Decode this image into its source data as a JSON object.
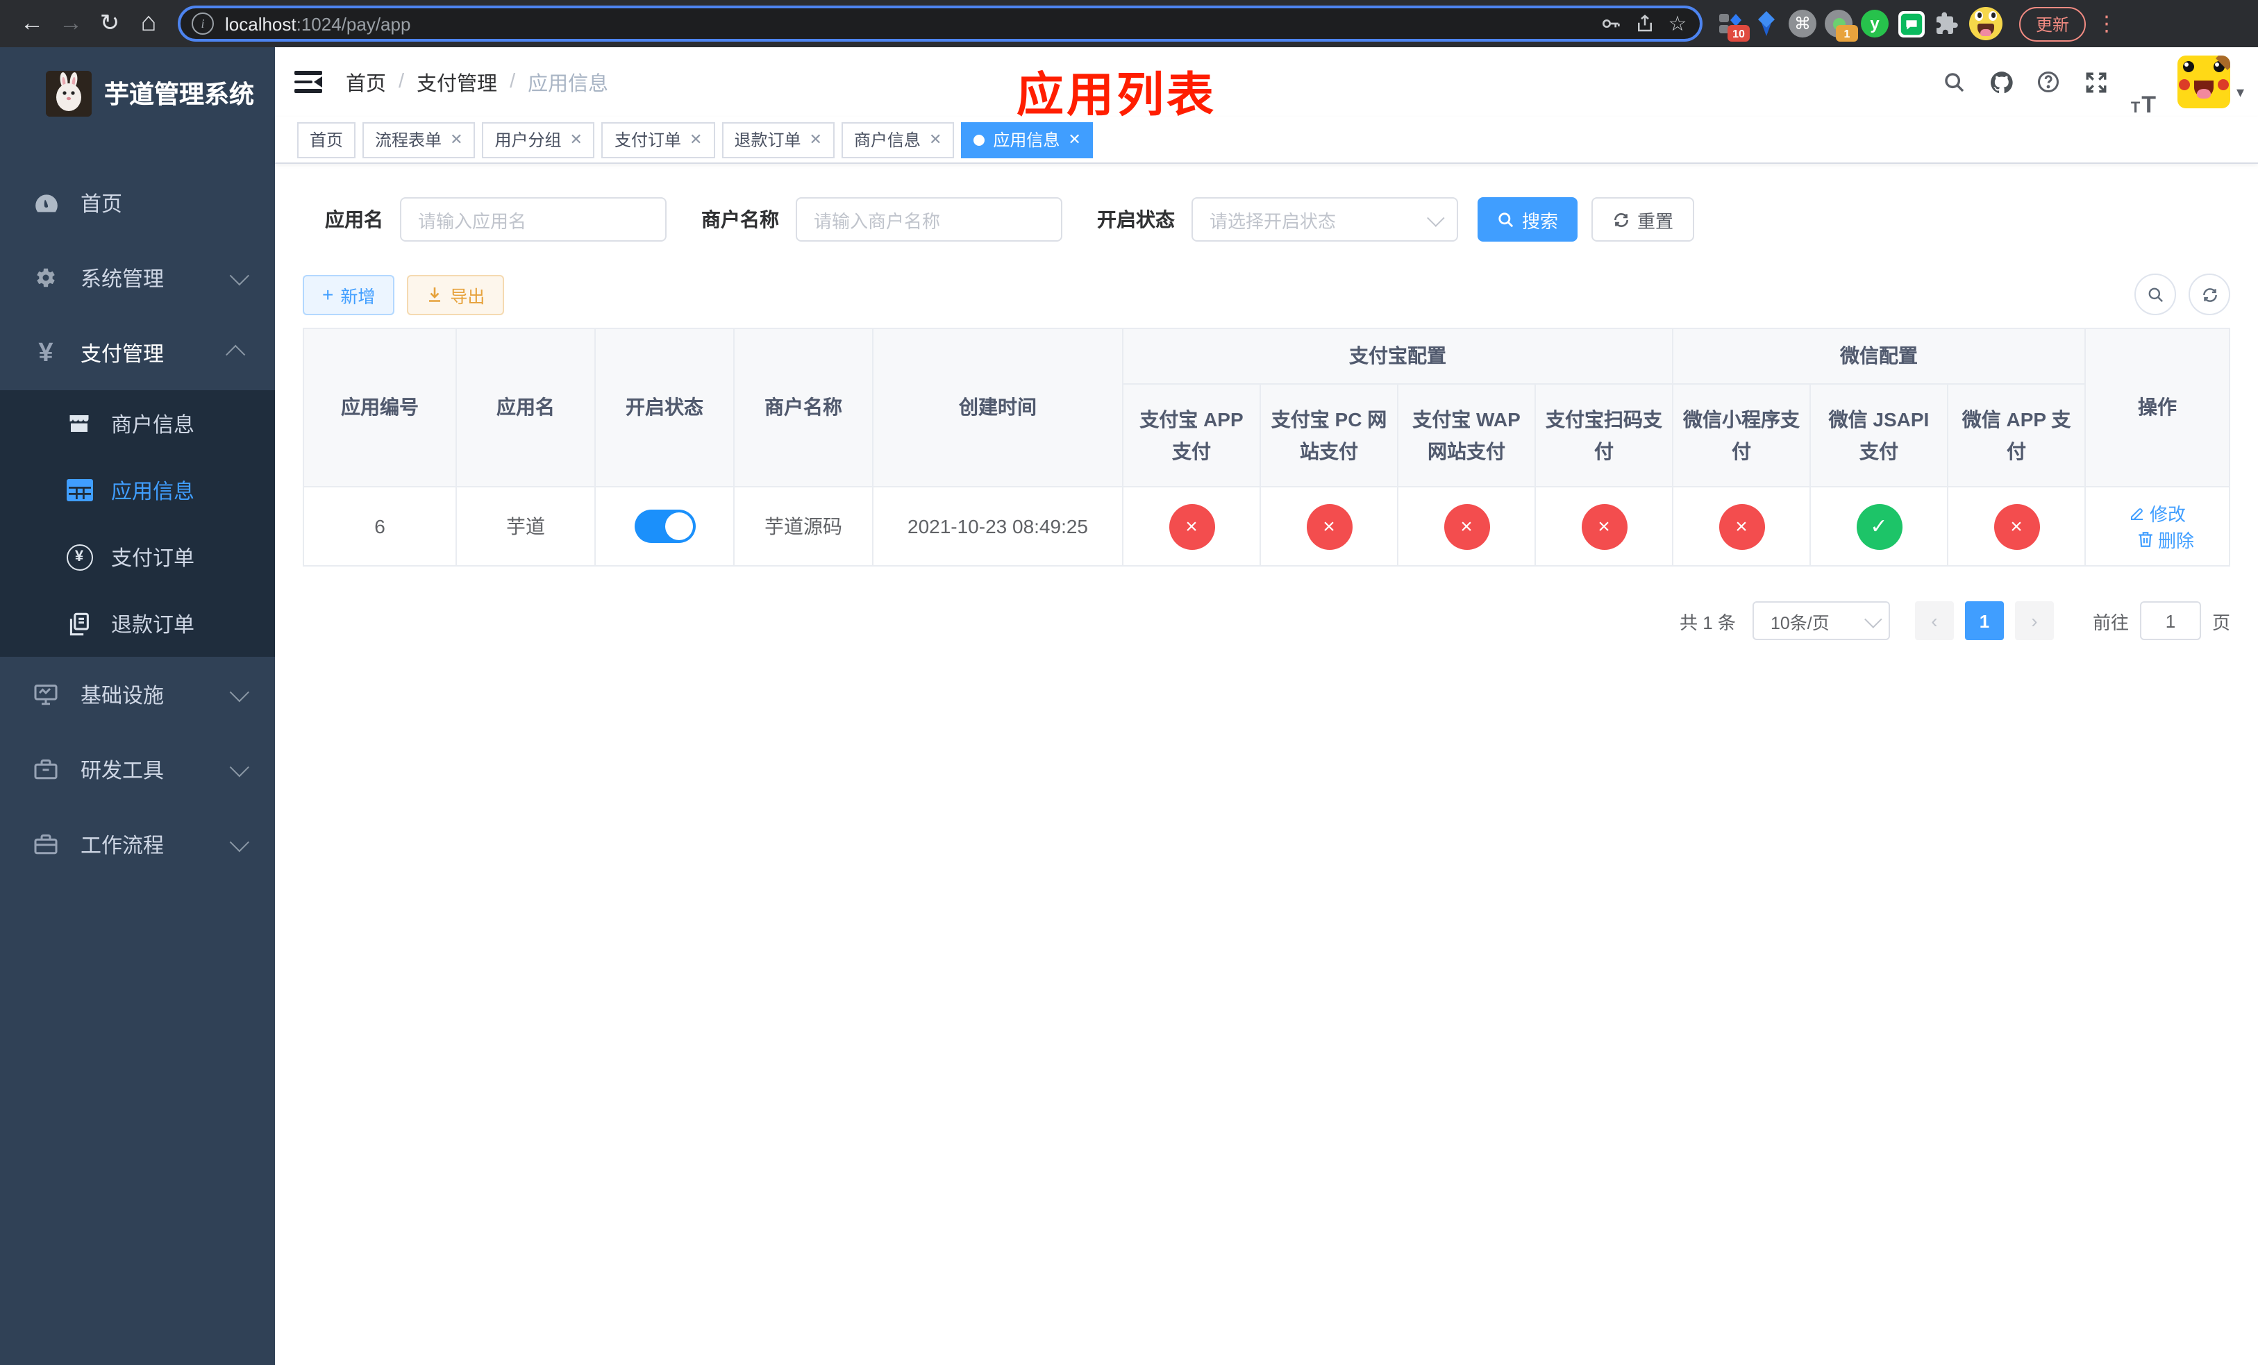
{
  "browser": {
    "host": "localhost",
    "path": ":1024/pay/app",
    "update_label": "更新",
    "ext_badge_blocks": "10",
    "ext_badge_rec": "1",
    "ext_y_letter": "y",
    "ext_cmd_glyph": "⌘"
  },
  "sidebar": {
    "title": "芋道管理系统",
    "menu": [
      {
        "label": "首页"
      },
      {
        "label": "系统管理"
      },
      {
        "label": "支付管理"
      }
    ],
    "submenu": [
      {
        "label": "商户信息"
      },
      {
        "label": "应用信息"
      },
      {
        "label": "支付订单"
      },
      {
        "label": "退款订单"
      }
    ],
    "menu2": [
      {
        "label": "基础设施"
      },
      {
        "label": "研发工具"
      },
      {
        "label": "工作流程"
      }
    ]
  },
  "header": {
    "crumb1": "首页",
    "crumb2": "支付管理",
    "crumb3": "应用信息",
    "annotation": "应用列表"
  },
  "tabs": [
    {
      "label": "首页"
    },
    {
      "label": "流程表单"
    },
    {
      "label": "用户分组"
    },
    {
      "label": "支付订单"
    },
    {
      "label": "退款订单"
    },
    {
      "label": "商户信息"
    },
    {
      "label": "应用信息"
    }
  ],
  "search": {
    "name_label": "应用名",
    "name_ph": "请输入应用名",
    "merchant_label": "商户名称",
    "merchant_ph": "请输入商户名称",
    "status_label": "开启状态",
    "status_ph": "请选择开启状态",
    "search_btn": "搜索",
    "reset_btn": "重置"
  },
  "toolbar": {
    "add": "新增",
    "export": "导出"
  },
  "table": {
    "columns": {
      "app_id": "应用编号",
      "app_name": "应用名",
      "status": "开启状态",
      "merchant": "商户名称",
      "created": "创建时间",
      "group_alipay": "支付宝配置",
      "group_wechat": "微信配置",
      "alipay_app": "支付宝 APP 支付",
      "alipay_pc": "支付宝 PC 网站支付",
      "alipay_wap": "支付宝 WAP 网站支付",
      "alipay_qr": "支付宝扫码支付",
      "wx_mini": "微信小程序支付",
      "wx_jsapi": "微信 JSAPI 支付",
      "wx_app": "微信 APP 支付",
      "actions": "操作"
    },
    "row": {
      "id": "6",
      "name": "芋道",
      "enabled": true,
      "merchant": "芋道源码",
      "created": "2021-10-23 08:49:25",
      "pay_status": [
        false,
        false,
        false,
        false,
        false,
        true,
        false
      ],
      "edit_label": "修改",
      "delete_label": "删除"
    }
  },
  "pagination": {
    "total": "共 1 条",
    "size": "10条/页",
    "prev": "‹",
    "page": "1",
    "next": "›",
    "goto_label": "前往",
    "goto_value": "1",
    "unit": "页"
  },
  "colors": {
    "accent": "#409eff",
    "danger": "#f34d4e",
    "success": "#1dc468",
    "warning": "#e6a23c",
    "sidebar_bg": "#304156",
    "submenu_bg": "#1f2d3d"
  }
}
